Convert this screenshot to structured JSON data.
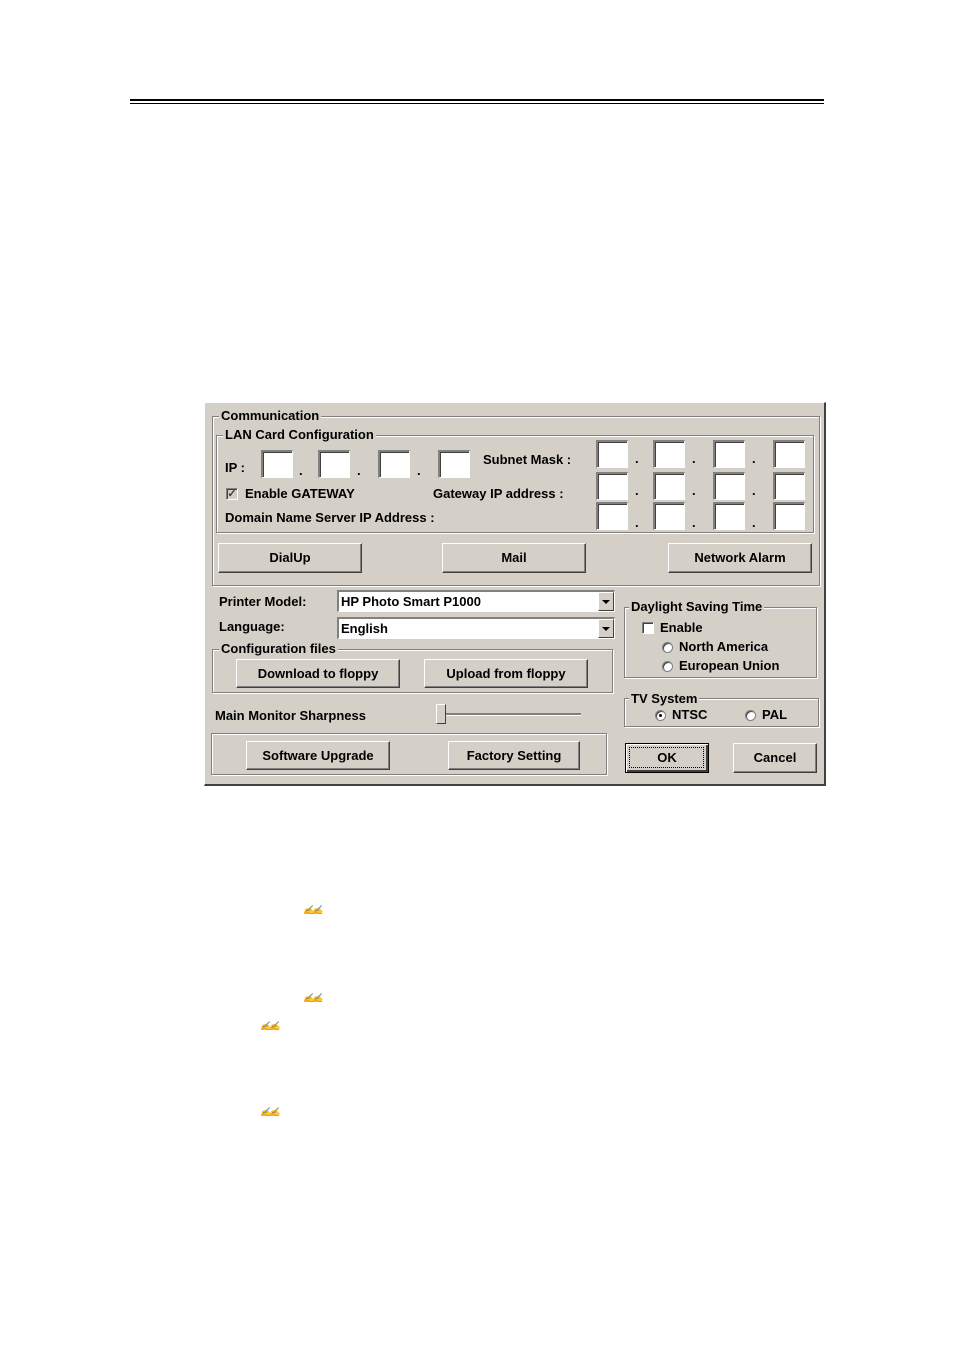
{
  "dialog": {
    "communication": {
      "title": "Communication",
      "lan": {
        "title": "LAN Card Configuration",
        "ip_label": "IP :",
        "ip_values": [
          "",
          "",
          "",
          ""
        ],
        "subnet_label": "Subnet Mask :",
        "subnet_values": [
          "",
          "",
          "",
          ""
        ],
        "enable_gateway_label": "Enable GATEWAY",
        "enable_gateway_checked": true,
        "gateway_label": "Gateway IP address :",
        "gateway_values": [
          "",
          "",
          "",
          ""
        ],
        "dns_label": "Domain Name Server IP  Address :",
        "dns_values": [
          "",
          "",
          "",
          ""
        ],
        "separator": "."
      },
      "buttons": {
        "dialup": "DialUp",
        "mail": "Mail",
        "network_alarm": "Network Alarm"
      }
    },
    "printer_model": {
      "label": "Printer Model:",
      "value": "HP Photo Smart P1000"
    },
    "language": {
      "label": "Language:",
      "value": "English"
    },
    "config_files": {
      "title": "Configuration files",
      "download": "Download to floppy",
      "upload": "Upload from floppy"
    },
    "sharpness": {
      "label": "Main Monitor Sharpness",
      "value_fraction": 0.0
    },
    "software_upgrade": "Software Upgrade",
    "factory_setting": "Factory Setting",
    "dst": {
      "title": "Daylight Saving Time",
      "enable_label": "Enable",
      "enable_checked": false,
      "options": [
        "North America",
        "European Union"
      ],
      "selected": null
    },
    "tv_system": {
      "title": "TV System",
      "options": [
        "NTSC",
        "PAL"
      ],
      "selected": "NTSC"
    },
    "ok": "OK",
    "cancel": "Cancel"
  },
  "document": {
    "bullet_glyph": "✍✍"
  }
}
